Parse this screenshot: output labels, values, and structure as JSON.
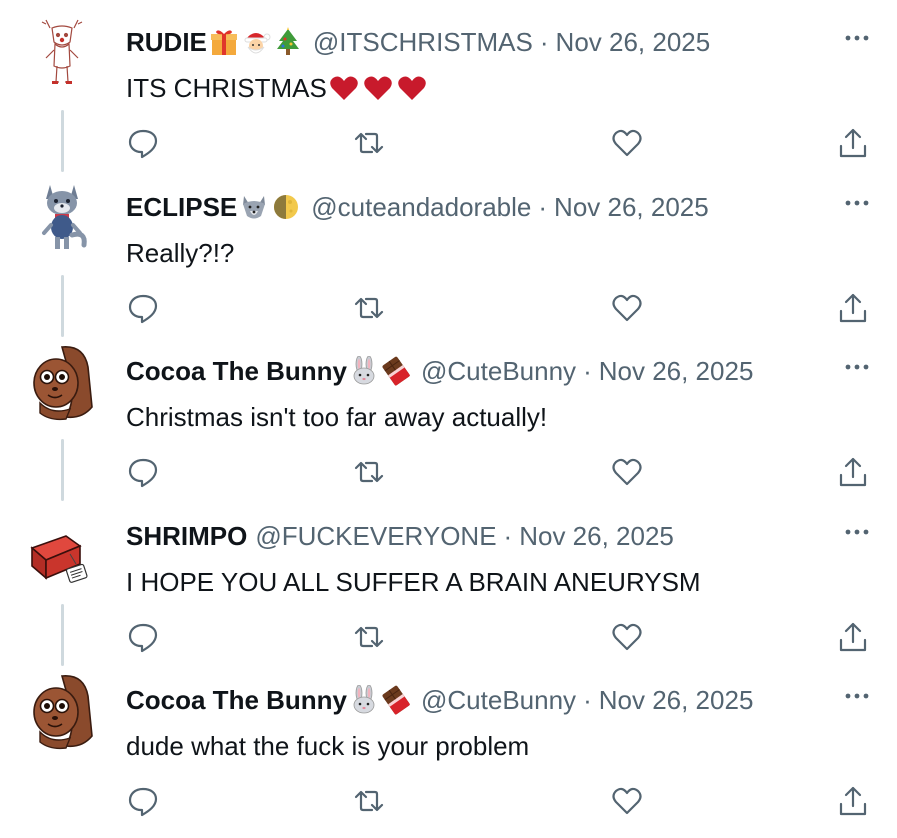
{
  "thread": {
    "tweets": [
      {
        "name": "RUDIE",
        "name_emojis": [
          "gift-emoji",
          "santa-emoji",
          "christmas-tree-emoji"
        ],
        "handle": "@ITSCHRISTMAS",
        "separator": "·",
        "date": "Nov 26, 2025",
        "text": "ITS CHRISTMAS",
        "text_emojis": [
          "red-heart-emoji",
          "red-heart-emoji",
          "red-heart-emoji"
        ],
        "avatar_icon": "reindeer-sketch-avatar"
      },
      {
        "name": "ECLIPSE",
        "name_emojis": [
          "wolf-emoji",
          "moon-emoji"
        ],
        "handle": "@cuteandadorable",
        "separator": "·",
        "date": "Nov 26, 2025",
        "text": "Really?!?",
        "text_emojis": [],
        "avatar_icon": "gray-wolf-avatar"
      },
      {
        "name": "Cocoa The Bunny",
        "name_emojis": [
          "rabbit-emoji",
          "chocolate-bar-emoji"
        ],
        "handle": "@CuteBunny",
        "separator": "·",
        "date": "Nov 26, 2025",
        "text": "Christmas isn't too far away actually!",
        "text_emojis": [],
        "avatar_icon": "brown-bunny-avatar"
      },
      {
        "name": "SHRIMPO",
        "name_emojis": [],
        "handle": "@FUCKEVERYONE",
        "separator": "·",
        "date": "Nov 26, 2025",
        "text": "I HOPE YOU ALL SUFFER A BRAIN ANEURYSM",
        "text_emojis": [],
        "avatar_icon": "red-brick-avatar"
      },
      {
        "name": "Cocoa The Bunny",
        "name_emojis": [
          "rabbit-emoji",
          "chocolate-bar-emoji"
        ],
        "handle": "@CuteBunny",
        "separator": "·",
        "date": "Nov 26, 2025",
        "text": "dude what the fuck is your problem",
        "text_emojis": [],
        "avatar_icon": "brown-bunny-avatar"
      }
    ]
  },
  "icons": {
    "reply": "reply-icon",
    "retweet": "retweet-icon",
    "like": "heart-icon",
    "share": "share-icon",
    "more": "more-dots-icon"
  },
  "colors": {
    "text_primary": "#0f1419",
    "text_secondary": "#536471",
    "thread_line": "#cfd9de",
    "icon_gray": "#536471",
    "heart_red": "#d1203c"
  }
}
